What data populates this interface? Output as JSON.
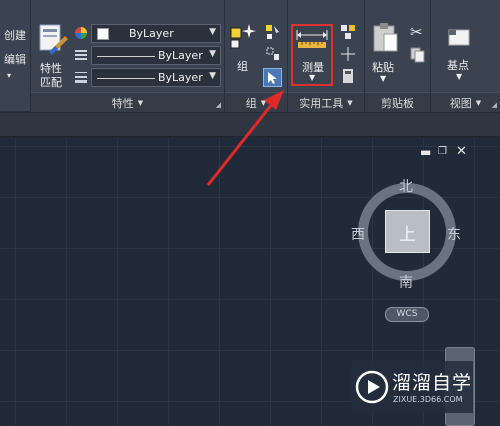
{
  "ribbon": {
    "left_panel": {
      "create": "创建",
      "edit": "编辑"
    },
    "properties": {
      "match_label_1": "特性",
      "match_label_2": "匹配",
      "color_value": "ByLayer",
      "linetype_value": "ByLayer",
      "lineweight_value": "ByLayer",
      "panel_title": "特性"
    },
    "group": {
      "button_label": "组",
      "panel_title": "组"
    },
    "utilities": {
      "measure_label": "测量",
      "panel_title": "实用工具"
    },
    "clipboard": {
      "paste_label": "粘贴",
      "panel_title": "剪贴板"
    },
    "view": {
      "base_label": "基点",
      "panel_title": "视图"
    }
  },
  "viewcube": {
    "north": "北",
    "south": "南",
    "east": "东",
    "west": "西",
    "top": "上",
    "ucs": "WCS"
  },
  "watermark": {
    "title": "溜溜自学",
    "url": "ZIXUE.3D66.COM"
  },
  "colors": {
    "highlight": "#e03030",
    "canvas": "#212a38",
    "ribbon": "#3b4250"
  }
}
